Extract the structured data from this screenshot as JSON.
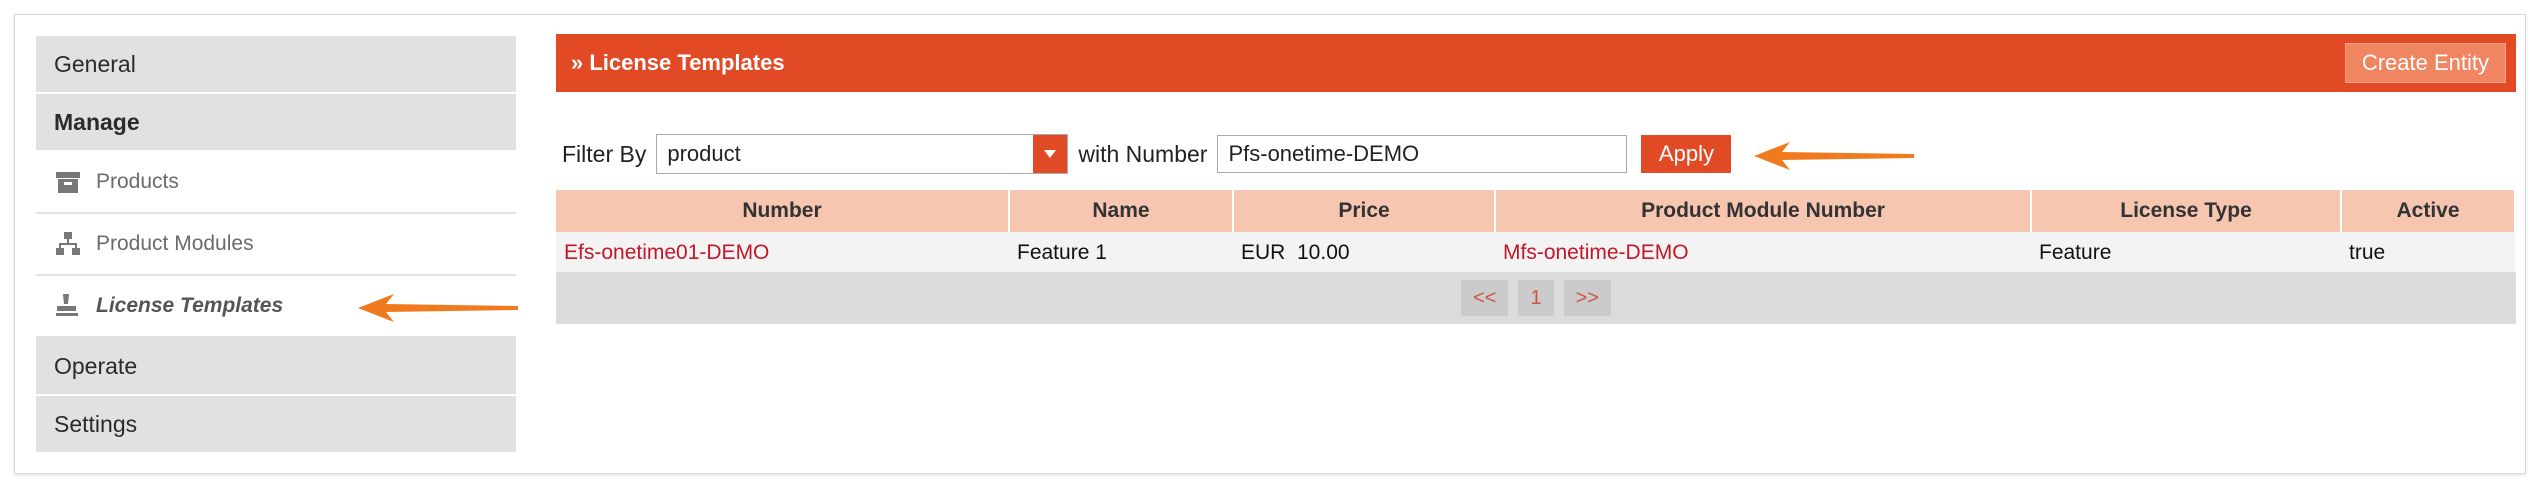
{
  "sidebar": {
    "sections": [
      {
        "label": "General"
      },
      {
        "label": "Manage"
      }
    ],
    "items": [
      {
        "label": "Products",
        "icon": "box-icon"
      },
      {
        "label": "Product Modules",
        "icon": "hierarchy-icon"
      },
      {
        "label": "License Templates",
        "icon": "stamp-icon"
      }
    ],
    "bottom_sections": [
      {
        "label": "Operate"
      },
      {
        "label": "Settings"
      }
    ]
  },
  "header": {
    "title": "» License Templates",
    "create_button": "Create Entity"
  },
  "filter": {
    "filter_by_label": "Filter By",
    "selected": "product",
    "with_number_label": "with Number",
    "number_value": "Pfs-onetime-DEMO",
    "apply_label": "Apply"
  },
  "table": {
    "columns": [
      "Number",
      "Name",
      "Price",
      "Product Module Number",
      "License Type",
      "Active"
    ],
    "rows": [
      {
        "number": "Efs-onetime01-DEMO",
        "name": "Feature 1",
        "price": "EUR  10.00",
        "module": "Mfs-onetime-DEMO",
        "type": "Feature",
        "active": "true"
      }
    ]
  },
  "pager": {
    "prev": "<<",
    "page": "1",
    "next": ">>"
  },
  "colors": {
    "accent": "#e24a26",
    "header_row": "#f7c6b1",
    "link": "#c3162a",
    "annotation_arrow": "#f07b1e"
  }
}
